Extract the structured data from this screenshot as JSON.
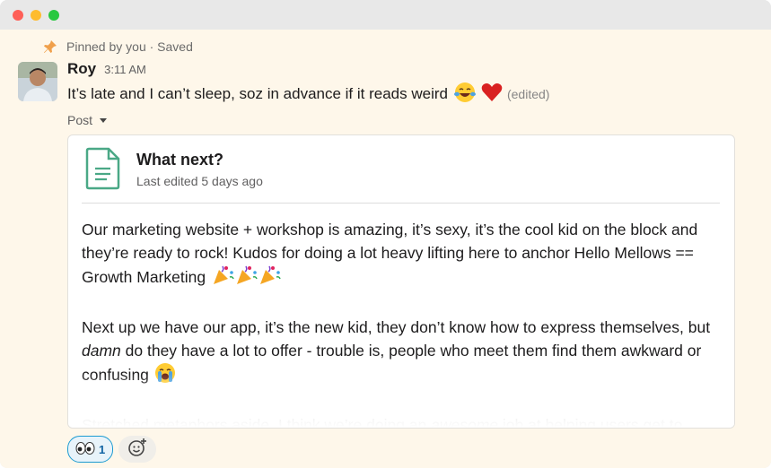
{
  "pinned": {
    "text": "Pinned by you · Saved"
  },
  "message": {
    "author": "Roy",
    "time": "3:11 AM",
    "text": "It’s late and I can’t sleep, soz in advance if it reads weird",
    "edited": "(edited)",
    "emojis": [
      "laughing-tears",
      "red-heart"
    ]
  },
  "attachment_label": "Post",
  "post": {
    "title": "What next?",
    "subtitle": "Last edited 5 days ago",
    "paragraphs": [
      {
        "before": "Our marketing website + workshop is amazing, it’s sexy, it’s the cool kid on the block and they’re ready to rock! Kudos for doing a lot heavy lifting here to anchor Hello Mellows == Growth Marketing",
        "em": "",
        "after": ""
      },
      {
        "before": "Next up we have our app, it’s the new kid, they don’t know how to express themselves, but ",
        "em": "damn",
        "after": " do they have a lot to offer - trouble is, people who meet them find them awkward or confusing"
      },
      {
        "before": "Stretched metaphors aside, I think we’re doing an ",
        "em": "awesome",
        "after": " job at helping users get to"
      }
    ]
  },
  "reactions": [
    {
      "emoji": "eyes",
      "count": "1"
    }
  ],
  "colors": {
    "background": "#fef7ea",
    "accent_blue": "#1264a3",
    "doc_icon_green": "#4aa886"
  }
}
